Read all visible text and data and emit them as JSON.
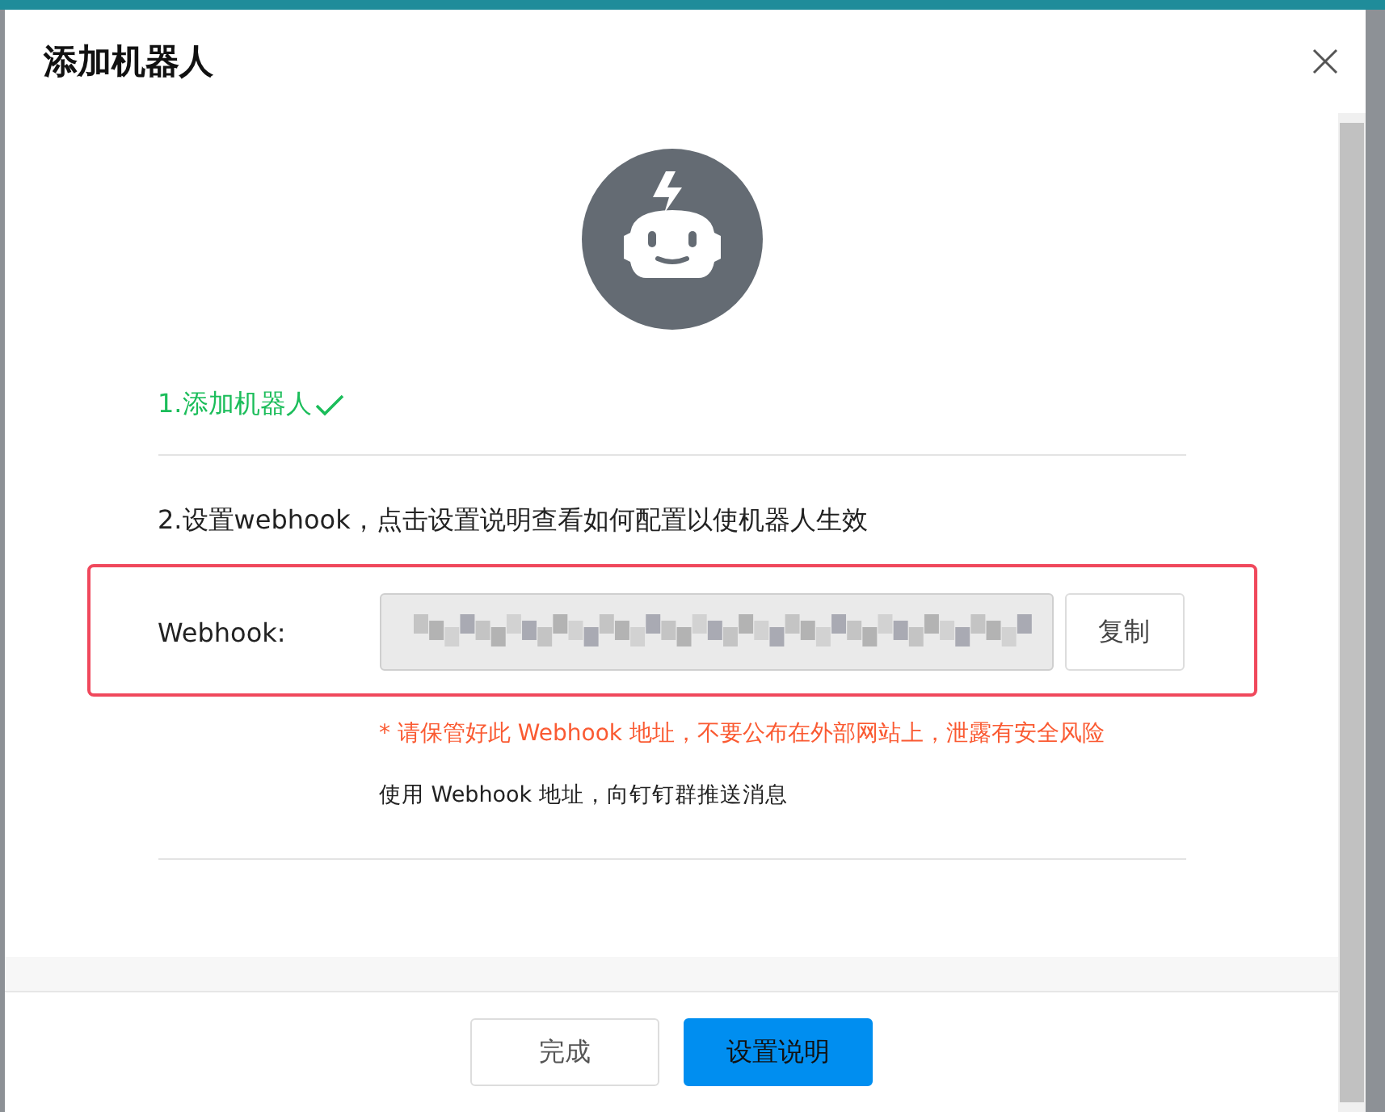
{
  "dialog": {
    "title": "添加机器人"
  },
  "steps": [
    {
      "text": "1.添加机器人",
      "completed": true
    },
    {
      "text": "2.设置webhook，点击设置说明查看如何配置以使机器人生效",
      "completed": false
    }
  ],
  "webhook": {
    "label": "Webhook:",
    "copy_button": "复制",
    "warning": "* 请保管好此 Webhook 地址，不要公布在外部网站上，泄露有安全风险",
    "note": "使用 Webhook 地址，向钉钉群推送消息"
  },
  "buttons": [
    {
      "label": "完成",
      "primary": false
    },
    {
      "label": "设置说明",
      "primary": true
    }
  ]
}
